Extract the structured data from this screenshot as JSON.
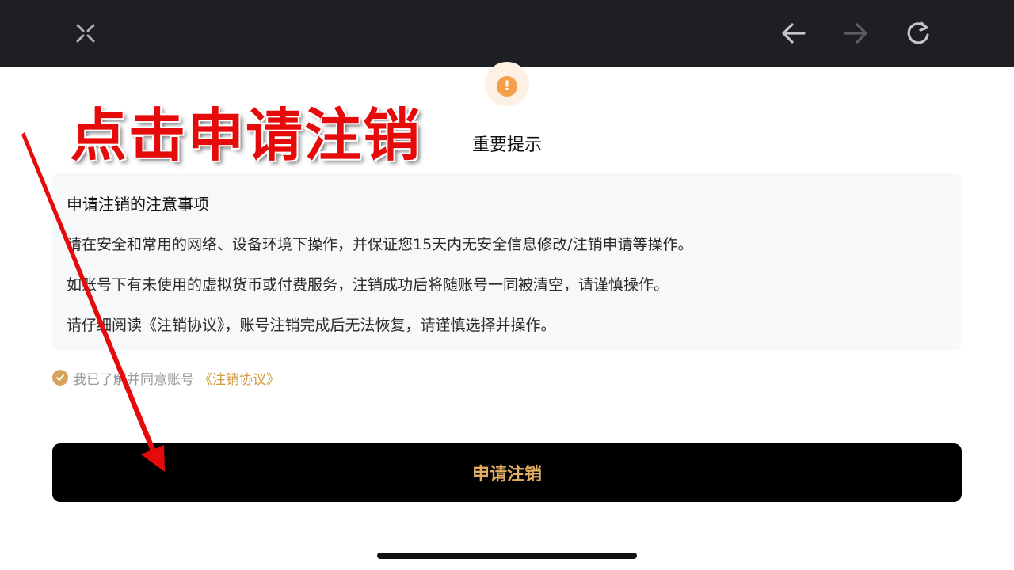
{
  "topbar": {
    "close_icon": "close-x-icon",
    "back_icon": "arrow-left-icon",
    "forward_icon": "arrow-right-icon",
    "refresh_icon": "refresh-icon",
    "background": "#1e1f24"
  },
  "header": {
    "warning_glyph": "!",
    "title": "重要提示"
  },
  "annotation": {
    "text": "点击申请注销",
    "color": "#e60b0b"
  },
  "notice": {
    "heading": "申请注销的注意事项",
    "items": [
      "请在安全和常用的网络、设备环境下操作，并保证您15天内无安全信息修改/注销申请等操作。",
      "如账号下有未使用的虚拟货币或付费服务，注销成功后将随账号一同被清空，请谨慎操作。",
      "请仔细阅读《注销协议》，账号注销完成后无法恢复，请谨慎选择并操作。"
    ]
  },
  "agreement": {
    "checked": true,
    "text": "我已了解并同意账号",
    "link": "《注销协议》"
  },
  "primary_button": {
    "label": "申请注销",
    "label_color": "#e2ad63",
    "background": "#000000"
  },
  "accent_color": "#d49a3f"
}
